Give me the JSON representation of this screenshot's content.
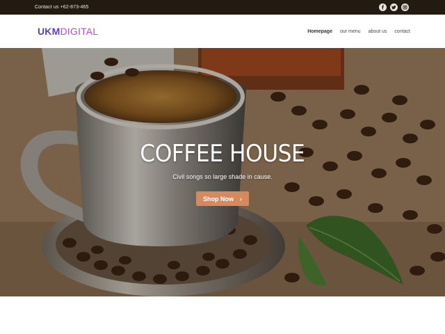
{
  "topbar": {
    "contact_text": "Contact us +62-873-465",
    "social_icons": [
      "facebook-icon",
      "twitter-icon",
      "instagram-icon"
    ]
  },
  "header": {
    "logo_bold": "UKM",
    "logo_light": "DIGITAL",
    "nav": [
      {
        "label": "Homepage",
        "active": true
      },
      {
        "label": "our menu",
        "active": false
      },
      {
        "label": "about us",
        "active": false
      },
      {
        "label": "contact",
        "active": false
      }
    ]
  },
  "hero": {
    "title": "COFFEE HOUSE",
    "subtitle": "Civil songs so large shade in cause.",
    "button_label": "Shop Now",
    "button_icon": "chevron-right-icon"
  },
  "colors": {
    "topbar_bg": "#231a12",
    "logo_primary": "#5a3fbf",
    "logo_secondary": "#b04fc8",
    "button_bg": "#d48a5e"
  }
}
